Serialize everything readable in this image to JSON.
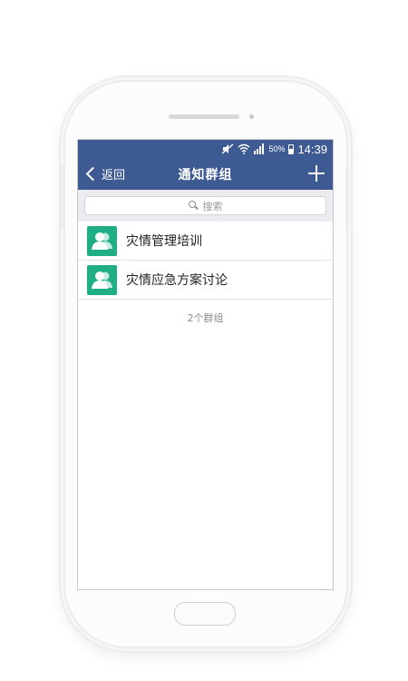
{
  "status_bar": {
    "battery": "50%",
    "time": "14:39",
    "icons": [
      "mute-icon",
      "wifi-icon",
      "signal-icon",
      "battery-icon"
    ]
  },
  "nav": {
    "back_label": "返回",
    "title": "通知群组",
    "add_icon": "plus-icon"
  },
  "search": {
    "placeholder": "搜索",
    "icon": "search-icon"
  },
  "groups": [
    {
      "name": "灾情管理培训",
      "icon": "group-avatar-icon"
    },
    {
      "name": "灾情应急方案讨论",
      "icon": "group-avatar-icon"
    }
  ],
  "footer": {
    "count_label": "2个群组"
  },
  "colors": {
    "nav_bar": "#3e5a93",
    "avatar": "#1fae86",
    "search_bg": "#ebebf0"
  }
}
